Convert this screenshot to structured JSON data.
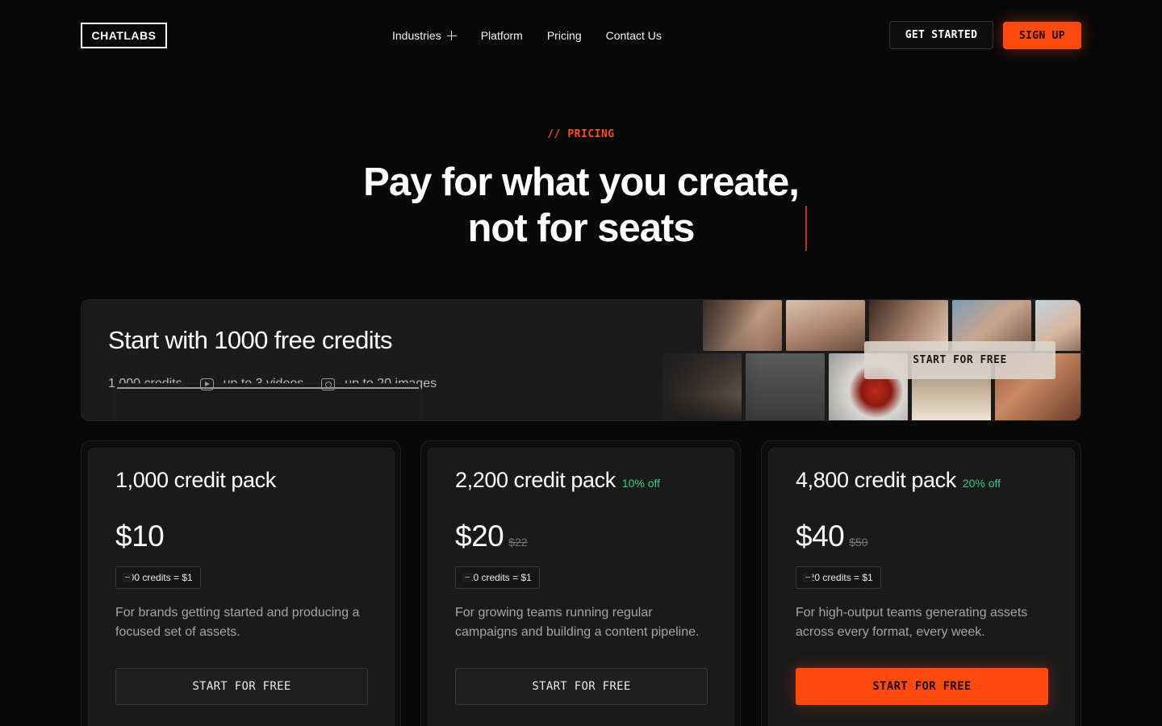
{
  "header": {
    "logo": "CHATLABS",
    "nav": [
      {
        "label": "Industries",
        "has_plus": true
      },
      {
        "label": "Platform"
      },
      {
        "label": "Pricing"
      },
      {
        "label": "Contact Us"
      }
    ],
    "get_started": "GET STARTED",
    "sign_up": "SIGN UP"
  },
  "hero": {
    "eyebrow": "// PRICING",
    "title_line1": "Pay for what you create,",
    "title_line2": "not for seats"
  },
  "banner": {
    "title": "Start with 1000 free credits",
    "features": [
      {
        "icon": "credit-card-icon",
        "label": "1,000 credits"
      },
      {
        "icon": "video-camera-icon",
        "label": "up to 3 videos"
      },
      {
        "icon": "image-icon",
        "label": "up to 20 images"
      }
    ],
    "cta": "START FOR FREE"
  },
  "plans": [
    {
      "title": "1,000 credit pack",
      "discount": "",
      "price": "$10",
      "old_price": "",
      "rate": "100 credits = $1",
      "description": "For brands getting started and producing a focused set of assets.",
      "cta": "START FOR FREE"
    },
    {
      "title": "2,200 credit pack",
      "discount": "10% off",
      "price": "$20",
      "old_price": "$22",
      "rate": "110 credits = $1",
      "description": "For growing teams running regular campaigns and building a content pipeline.",
      "cta": "START FOR FREE"
    },
    {
      "title": "4,800 credit pack",
      "discount": "20% off",
      "price": "$40",
      "old_price": "$50",
      "rate": "120 credits = $1",
      "description": "For high-output teams generating assets across every format, every week.",
      "cta": "START FOR FREE"
    }
  ],
  "colors": {
    "accent": "#ff4a0f",
    "discount": "#2fd08a",
    "background": "#080808",
    "card": "#1a1a1a"
  }
}
